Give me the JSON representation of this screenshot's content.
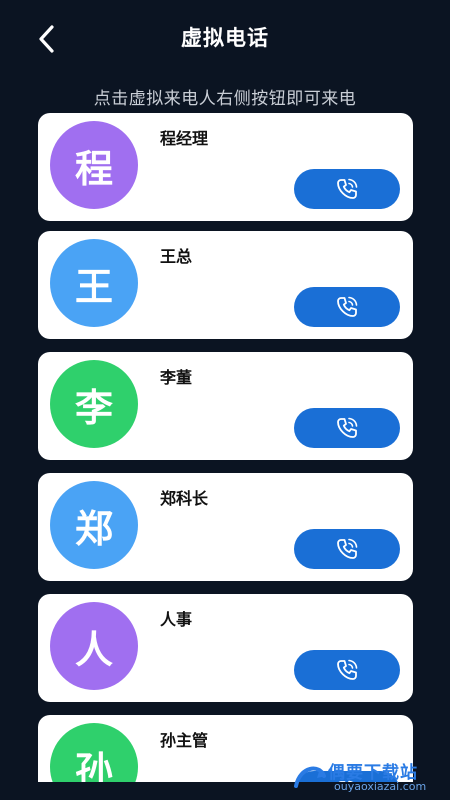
{
  "header": {
    "title": "虚拟电话",
    "hint": "点击虚拟来电人右侧按钮即可来电"
  },
  "contacts": [
    {
      "name": "程经理",
      "initial": "程",
      "color": "#a06ff0"
    },
    {
      "name": "王总",
      "initial": "王",
      "color": "#4aa3f5"
    },
    {
      "name": "李董",
      "initial": "李",
      "color": "#2fd06c"
    },
    {
      "name": "郑科长",
      "initial": "郑",
      "color": "#4aa3f5"
    },
    {
      "name": "人事",
      "initial": "人",
      "color": "#a06ff0"
    },
    {
      "name": "孙主管",
      "initial": "孙",
      "color": "#2fd06c"
    }
  ],
  "icons": {
    "back": "chevron-left-icon",
    "call": "phone-ringing-icon"
  },
  "watermark": {
    "text": "偶要下载站",
    "url": "ouyaoxiazai.com"
  }
}
